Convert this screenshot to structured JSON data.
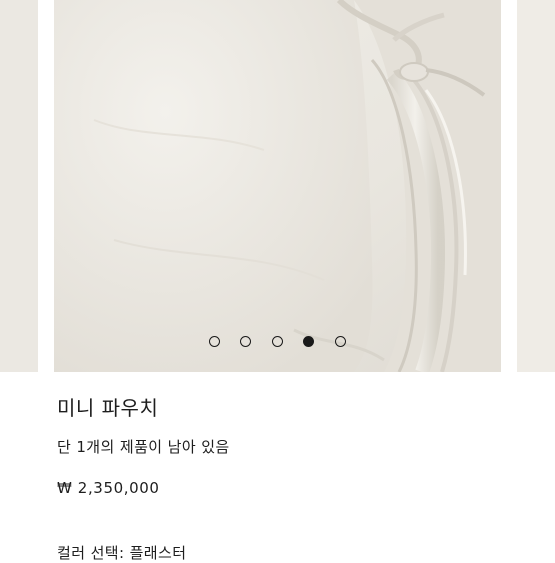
{
  "product": {
    "name": "미니 파우치",
    "stock_note": "단 1개의 제품이 남아 있음",
    "price": "₩ 2,350,000",
    "color_select": "컬러 선택: 플래스터"
  },
  "carousel": {
    "dot_count": 5,
    "active_index": 3
  },
  "colors": {
    "product_image_base": "#ece9e2",
    "dot": "#1a1a1a"
  }
}
